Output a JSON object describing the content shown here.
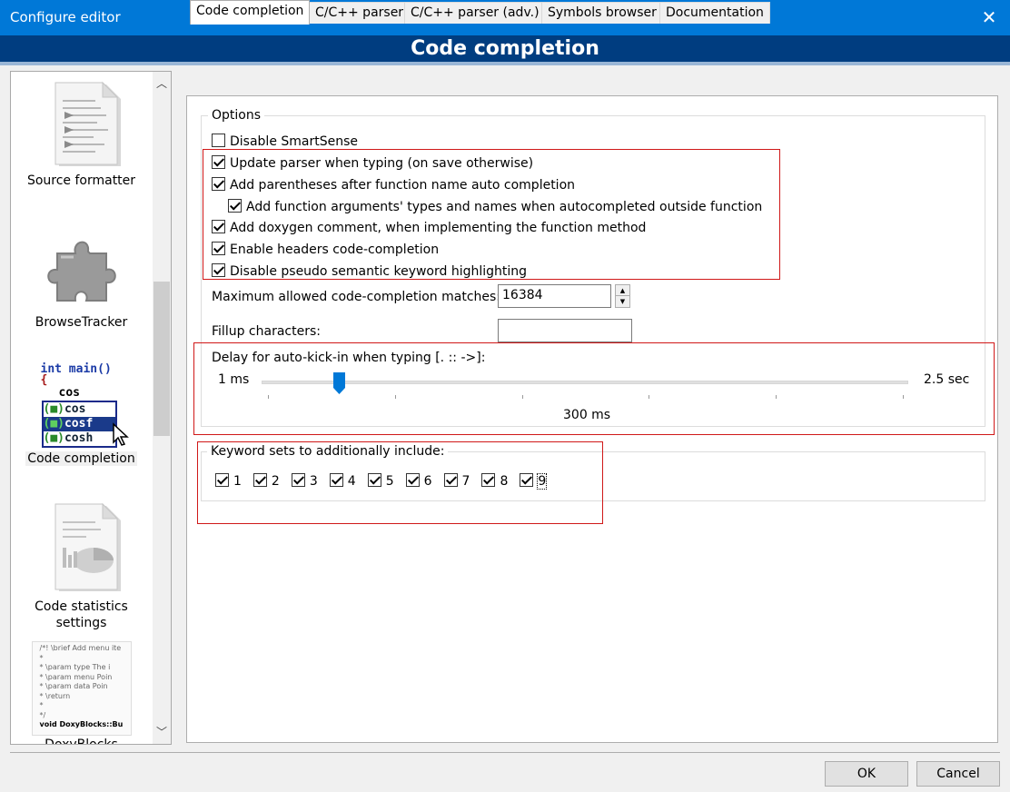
{
  "window": {
    "title": "Configure editor",
    "close_glyph": "✕"
  },
  "header": {
    "title": "Code completion"
  },
  "sidebar": {
    "items": [
      {
        "label": "Source formatter",
        "icon": "source-formatter-icon"
      },
      {
        "label": "BrowseTracker",
        "icon": "puzzle-piece-icon"
      },
      {
        "label": "Code completion",
        "icon": "code-completion-icon",
        "selected": true
      },
      {
        "label": "Code statistics settings",
        "icon": "code-statistics-icon"
      },
      {
        "label": "DoxyBlocks",
        "icon": "doxyblocks-icon"
      }
    ],
    "code_preview": {
      "line1": "int main()",
      "line2": "{",
      "line3": "cos",
      "suggestions": [
        "cos",
        "cosf",
        "cosh"
      ]
    },
    "doxy_preview": {
      "lines": [
        "/*! \\brief Add menu ite",
        " *",
        " * \\param type   The i",
        " * \\param menu  Poin",
        " * \\param data   Poin",
        " * \\return",
        " *",
        " */",
        "void DoxyBlocks::Bu"
      ]
    }
  },
  "tabs": [
    "Code completion",
    "C/C++ parser",
    "C/C++ parser (adv.)",
    "Symbols browser",
    "Documentation"
  ],
  "options": {
    "group_title": "Options",
    "checkboxes": [
      {
        "label": "Disable SmartSense",
        "checked": false
      },
      {
        "label": "Update parser when typing (on save otherwise)",
        "checked": true
      },
      {
        "label": "Add parentheses after function name auto completion",
        "checked": true
      },
      {
        "label": "Add function arguments' types and names when autocompleted outside function",
        "checked": true
      },
      {
        "label": "Add doxygen comment, when implementing the function method",
        "checked": true
      },
      {
        "label": "Enable headers code-completion",
        "checked": true
      },
      {
        "label": "Disable pseudo semantic keyword highlighting",
        "checked": true
      }
    ],
    "max_matches_label": "Maximum allowed code-completion matches:",
    "max_matches_value": "16384",
    "fillup_label": "Fillup characters:",
    "fillup_value": ""
  },
  "delay": {
    "label": "Delay for auto-kick-in when typing [. :: ->]:",
    "min_label": "1 ms",
    "max_label": "2.5 sec",
    "current_label": "300 ms",
    "fraction": 0.12
  },
  "keywords": {
    "label": "Keyword sets to additionally include:",
    "sets": [
      "1",
      "2",
      "3",
      "4",
      "5",
      "6",
      "7",
      "8",
      "9"
    ]
  },
  "buttons": {
    "ok": "OK",
    "cancel": "Cancel"
  }
}
